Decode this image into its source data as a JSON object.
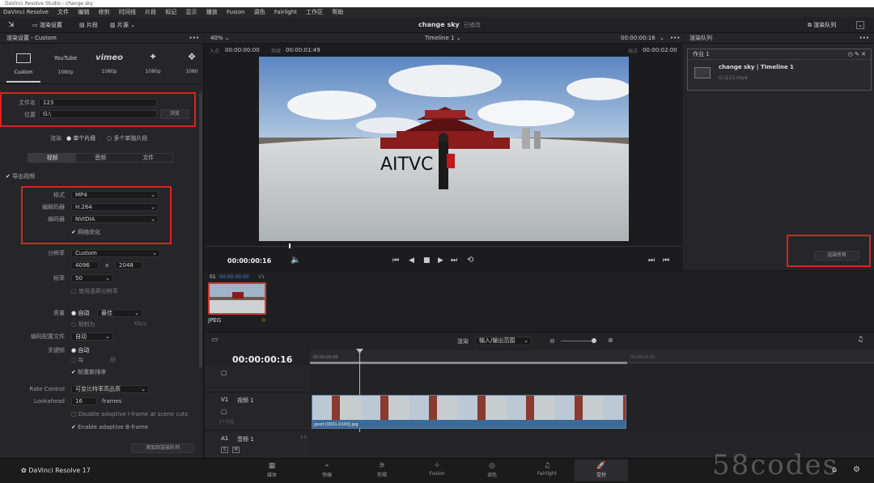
{
  "window_title": "DaVinci Resolve Studio - change sky",
  "menu": [
    "DaVinci Resolve",
    "文件",
    "编辑",
    "修剪",
    "时间线",
    "片段",
    "标记",
    "显示",
    "播放",
    "Fusion",
    "调色",
    "Fairlight",
    "工作区",
    "帮助"
  ],
  "toolbar": {
    "render_settings": "渲染设置",
    "clips": "片段",
    "pinboard": "片源",
    "project_title": "change sky",
    "project_status": "已修改",
    "render_queue": "渲染队列"
  },
  "render_settings": {
    "header": "渲染设置 - Custom",
    "presets": [
      {
        "label": "Custom"
      },
      {
        "label": "1080p",
        "brand": "YouTube"
      },
      {
        "label": "1080p",
        "brand": "vimeo"
      },
      {
        "label": "1080p",
        "brand": "twitter"
      },
      {
        "label": "1080",
        "brand": "dropbox"
      }
    ],
    "filename_label": "文件名",
    "filename_value": "123",
    "location_label": "位置",
    "location_value": "G:\\",
    "browse_label": "浏览",
    "render_label": "渲染",
    "single_clip": "单个片段",
    "individual_clips": "多个单独片段",
    "tabs": [
      "视频",
      "音频",
      "文件"
    ],
    "export_video": "导出视频",
    "format_label": "格式",
    "format_value": "MP4",
    "codec_label": "编解码器",
    "codec_value": "H.264",
    "encoder_label": "编码器",
    "encoder_value": "NVIDIA",
    "network_opt": "网络优化",
    "resolution_label": "分辨率",
    "resolution_value": "Custom",
    "res_w": "4096",
    "res_x": "x",
    "res_h": "2048",
    "framerate_label": "帧率",
    "framerate_value": "50",
    "pixel_aspect": "使用竖屏分辨率",
    "quality_label": "质量",
    "quality_auto": "自动",
    "quality_best": "最佳",
    "quality_limit": "限制为",
    "quality_kb": "Kb/s",
    "encoding_profile_label": "编码配置文件",
    "encoding_profile_value": "自动",
    "keyframes_label": "关键帧",
    "keyframes_auto": "自动",
    "keyframes_every": "每",
    "keyframes_frames": "帧",
    "frame_reorder": "帧重新排序",
    "rate_control_label": "Rate Control",
    "rate_control_value": "可变比特率高品质",
    "lookahead_label": "Lookahead",
    "lookahead_value": "16",
    "lookahead_unit": "frames",
    "disable_iframe": "Disable adaptive I-frame at scene cuts",
    "enable_bframe": "Enable adaptive B-frame",
    "add_to_queue": "添加到渲染队列"
  },
  "viewer": {
    "zoom": "40%",
    "timeline_name": "Timeline 1",
    "top_timecode": "00:00:00:16",
    "in_label": "入点",
    "in_value": "00:00:00:00",
    "dur_label": "持续",
    "dur_value": "00:00:01:49",
    "out_label": "出点",
    "out_value": "00:00:02:00",
    "current_timecode": "00:00:00:16",
    "watermark_text": "AITVC"
  },
  "render_queue": {
    "header": "渲染队列",
    "job_title": "作业 1",
    "job_name": "change sky | Timeline 1",
    "job_path": "G:\\123.mp4",
    "render_all": "渲染所有"
  },
  "media": {
    "clip_num": "01",
    "clip_tc": "00:00:00:00",
    "clip_track": "V1",
    "clip_type": "JPEG"
  },
  "timeline": {
    "render_label": "渲染",
    "range_value": "输入/输出范围",
    "timecode": "00:00:00:16",
    "ruler_start": "00:00:00:00",
    "ruler_end": "00:00:01:00",
    "v1_label": "V1",
    "v1_name": "视频 1",
    "v1_clips": "1个片段",
    "video_clip_name": "good [0001-0100].jpg",
    "a1_label": "A1",
    "a1_name": "音频 1",
    "a1_level": "2.0",
    "a1_s": "S",
    "a1_m": "M"
  },
  "bottom": {
    "app_name": "DaVinci Resolve 17",
    "pages": [
      {
        "label": "媒体",
        "icon": "▦"
      },
      {
        "label": "快编",
        "icon": "⌁"
      },
      {
        "label": "剪辑",
        "icon": "⚞"
      },
      {
        "label": "Fusion",
        "icon": "✧"
      },
      {
        "label": "调色",
        "icon": "◎"
      },
      {
        "label": "Fairlight",
        "icon": "♫"
      },
      {
        "label": "交付",
        "icon": "🚀"
      }
    ],
    "watermark": "58codes"
  }
}
